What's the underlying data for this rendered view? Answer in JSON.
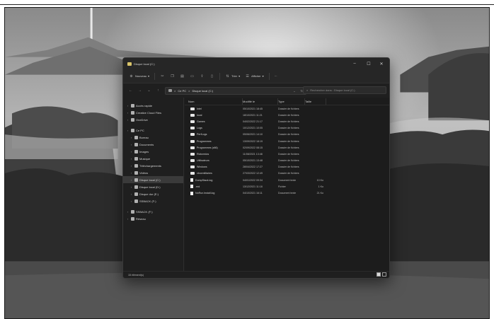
{
  "window": {
    "title": "Disque local (C:)",
    "controls": {
      "minimize": "–",
      "maximize": "☐",
      "close": "✕"
    }
  },
  "commandbar": {
    "new_label": "Nouveau",
    "sort_label": "Trier",
    "view_label": "Afficher",
    "more_label": "···"
  },
  "address": {
    "path": [
      "Ce PC",
      "Disque local (C:)"
    ],
    "separator": ">",
    "search_placeholder": "Rechercher dans : Disque local (C:)"
  },
  "navigation": {
    "items": [
      {
        "label": "Accès rapide",
        "icon": "star-icon",
        "indent": 0,
        "selected": false
      },
      {
        "label": "Creative Cloud Files",
        "icon": "cloud-icon",
        "indent": 0,
        "selected": false
      },
      {
        "label": "OneDrive",
        "icon": "onedrive-icon",
        "indent": 0,
        "selected": false
      },
      {
        "label": "Ce PC",
        "icon": "pc-icon",
        "indent": 0,
        "selected": false
      },
      {
        "label": "Bureau",
        "icon": "desktop-icon",
        "indent": 1,
        "selected": false
      },
      {
        "label": "Documents",
        "icon": "document-icon",
        "indent": 1,
        "selected": false
      },
      {
        "label": "Images",
        "icon": "image-icon",
        "indent": 1,
        "selected": false
      },
      {
        "label": "Musique",
        "icon": "music-icon",
        "indent": 1,
        "selected": false
      },
      {
        "label": "Téléchargements",
        "icon": "download-icon",
        "indent": 1,
        "selected": false
      },
      {
        "label": "Vidéos",
        "icon": "video-icon",
        "indent": 1,
        "selected": false
      },
      {
        "label": "Disque local (C:)",
        "icon": "drive-icon",
        "indent": 1,
        "selected": true
      },
      {
        "label": "Disque local (D:)",
        "icon": "drive-icon",
        "indent": 1,
        "selected": false
      },
      {
        "label": "Disque dur (E:)",
        "icon": "drive-icon",
        "indent": 1,
        "selected": false
      },
      {
        "label": "SSBACK (F:)",
        "icon": "drive-icon",
        "indent": 1,
        "selected": false
      },
      {
        "label": "SSBACK (F:)",
        "icon": "drive-icon",
        "indent": 0,
        "selected": false
      },
      {
        "label": "Réseau",
        "icon": "network-icon",
        "indent": 0,
        "selected": false
      }
    ]
  },
  "columns": {
    "name": "Nom",
    "date": "Modifié le",
    "type": "Type",
    "size": "Taille"
  },
  "files": [
    {
      "name": "Intel",
      "date": "05/10/2021 18:45",
      "type": "Dossier de fichiers",
      "size": "",
      "kind": "folder"
    },
    {
      "name": "local",
      "date": "18/10/2021 11:21",
      "type": "Dossier de fichiers",
      "size": "",
      "kind": "folder"
    },
    {
      "name": "Games",
      "date": "04/02/2022 21:17",
      "type": "Dossier de fichiers",
      "size": "",
      "kind": "folder"
    },
    {
      "name": "Logs",
      "date": "10/12/2021 10:05",
      "type": "Dossier de fichiers",
      "size": "",
      "kind": "folder"
    },
    {
      "name": "PerfLogs",
      "date": "05/06/2021 14:10",
      "type": "Dossier de fichiers",
      "size": "",
      "kind": "folder"
    },
    {
      "name": "Programmes",
      "date": "13/09/2022 18:19",
      "type": "Dossier de fichiers",
      "size": "",
      "kind": "folder"
    },
    {
      "name": "Programmes (x86)",
      "date": "02/09/2022 08:15",
      "type": "Dossier de fichiers",
      "size": "",
      "kind": "folder"
    },
    {
      "name": "Riotcredos",
      "date": "11/08/2021 13:48",
      "type": "Dossier de fichiers",
      "size": "",
      "kind": "folder"
    },
    {
      "name": "Utilisateurs",
      "date": "05/10/2021 13:48",
      "type": "Dossier de fichiers",
      "size": "",
      "kind": "folder"
    },
    {
      "name": "Windows",
      "date": "28/04/2022 17:27",
      "type": "Dossier de fichiers",
      "size": "",
      "kind": "folder"
    },
    {
      "name": "xboxmilitaires",
      "date": "27/03/2022 12:49",
      "type": "Dossier de fichiers",
      "size": "",
      "kind": "folder"
    },
    {
      "name": "DumpStack.log",
      "date": "04/01/2022 09:34",
      "type": "Document texte",
      "size": "10 Ko",
      "kind": "file"
    },
    {
      "name": ".rnd",
      "date": "13/12/2021 11:18",
      "type": "Fichier",
      "size": "1 Ko",
      "kind": "file"
    },
    {
      "name": "NoRun.Install.log",
      "date": "04/10/2021 16:11",
      "type": "Document texte",
      "size": "21 Ko",
      "kind": "file"
    }
  ],
  "status": {
    "count_text": "15 élément(s)"
  }
}
